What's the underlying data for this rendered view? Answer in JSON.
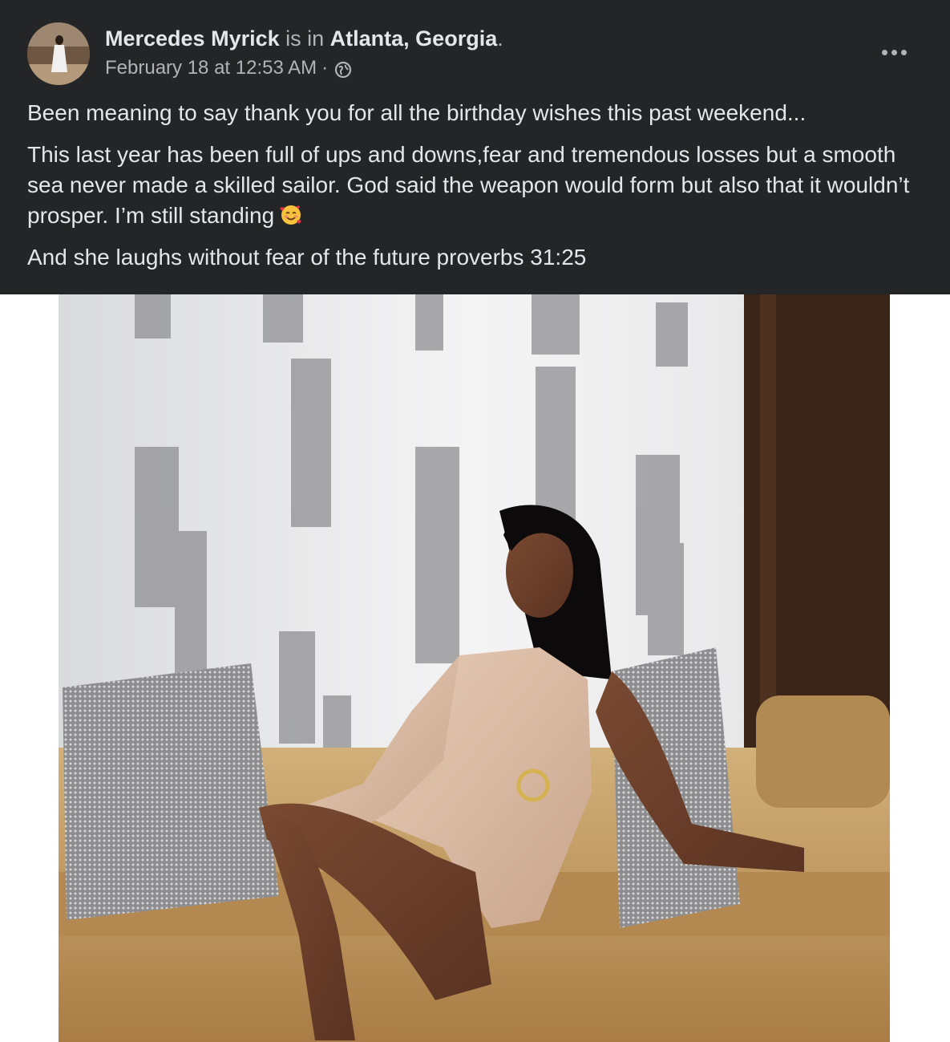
{
  "post": {
    "author": "Mercedes Myrick",
    "is_in": "is in",
    "location": "Atlanta, Georgia",
    "period": ".",
    "timestamp": "February 18 at 12:53 AM",
    "separator": "·",
    "privacy_icon": "globe-icon",
    "more_icon": "ellipsis-icon",
    "paragraphs": [
      "Been meaning to say thank you for all the birthday wishes this past weekend...",
      "This last year has been full of ups and downs,fear and tremendous losses but a smooth sea never made a skilled sailor. God said the weapon would form but also that it wouldn’t prosper. I’m still standing",
      "And she laughs without fear of the future proverbs 31:25"
    ],
    "emoji": "smiling-face-with-hearts-icon"
  },
  "colors": {
    "header_bg": "#242526",
    "primary_text": "#e4e6eb",
    "secondary_text": "#b0b3b8"
  }
}
